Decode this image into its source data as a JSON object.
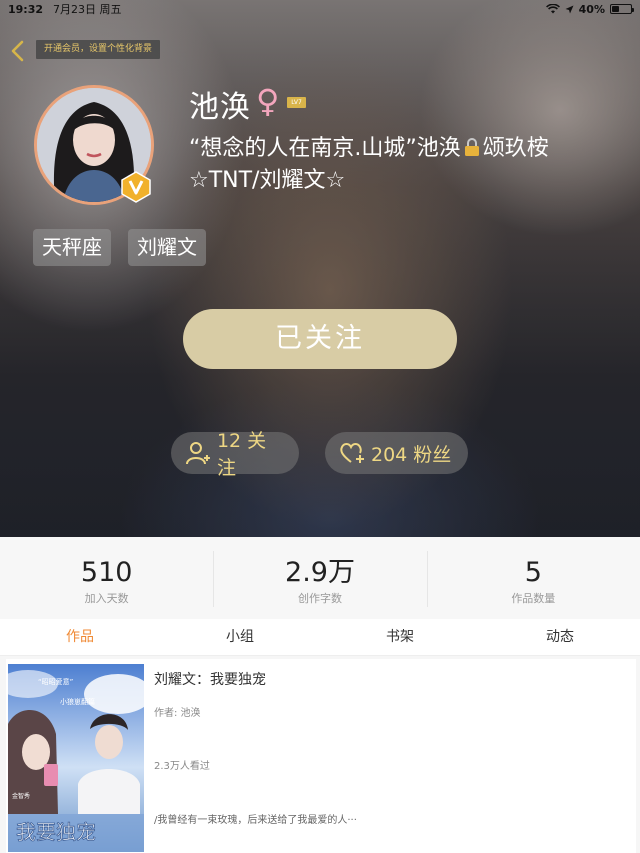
{
  "status_bar": {
    "time": "19:32",
    "date": "7月23日 周五",
    "battery": "40%",
    "battery_level": 0.4
  },
  "header": {
    "vip_tip": "开通会员，设置个性化背景",
    "username": "池涣",
    "gender_symbol": "♀",
    "level": "LV7",
    "bio_part1": "“想念的人在南京.山城”池涣",
    "bio_part2": "颂玖桉",
    "bio_line2": "☆TNT/刘耀文☆",
    "tags": [
      "天秤座",
      "刘耀文"
    ],
    "follow_button": "已关注",
    "follows_label": "12 关注",
    "fans_label": "204 粉丝",
    "accent_color": "#eed784"
  },
  "stats": [
    {
      "value": "510",
      "label": "加入天数"
    },
    {
      "value": "2.9万",
      "label": "创作字数"
    },
    {
      "value": "5",
      "label": "作品数量"
    }
  ],
  "tabs": [
    {
      "label": "作品",
      "active": true
    },
    {
      "label": "小组"
    },
    {
      "label": "书架"
    },
    {
      "label": "动态"
    }
  ],
  "book": {
    "title": "刘耀文：我要独宠",
    "author": "作者: 池涣",
    "views": "2.3万人看过",
    "desc": "/我曾经有一束玫瑰，后来送给了我最爱的人···",
    "cover_title": "我要独宠",
    "cover_sub": "“昭昭爱意”",
    "cover_sub2": "小狼崽翻篇",
    "cover_author": "金智秀"
  }
}
